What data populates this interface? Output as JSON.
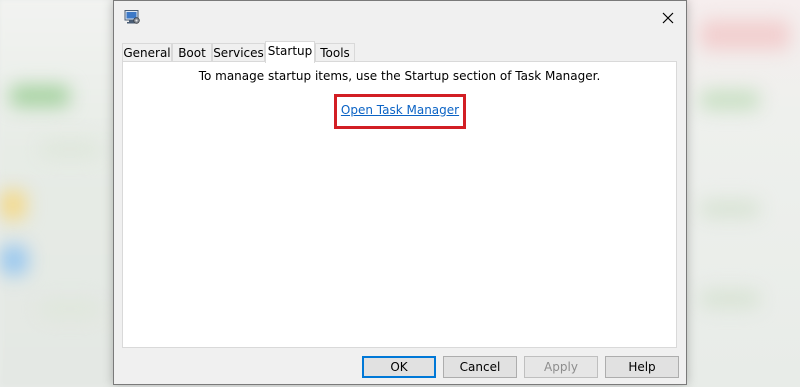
{
  "dialog": {
    "tabs": [
      {
        "label": "General"
      },
      {
        "label": "Boot"
      },
      {
        "label": "Services"
      },
      {
        "label": "Startup",
        "active": true
      },
      {
        "label": "Tools"
      }
    ],
    "startup": {
      "info_text": "To manage startup items, use the Startup section of Task Manager.",
      "link_text": "Open Task Manager"
    },
    "buttons": {
      "ok": "OK",
      "cancel": "Cancel",
      "apply": "Apply",
      "help": "Help"
    }
  },
  "icons": {
    "app": "system-configuration-icon",
    "close": "close-icon"
  },
  "colors": {
    "link": "#0b63c5",
    "highlight": "#d21e24",
    "default_button_border": "#0078d7"
  }
}
